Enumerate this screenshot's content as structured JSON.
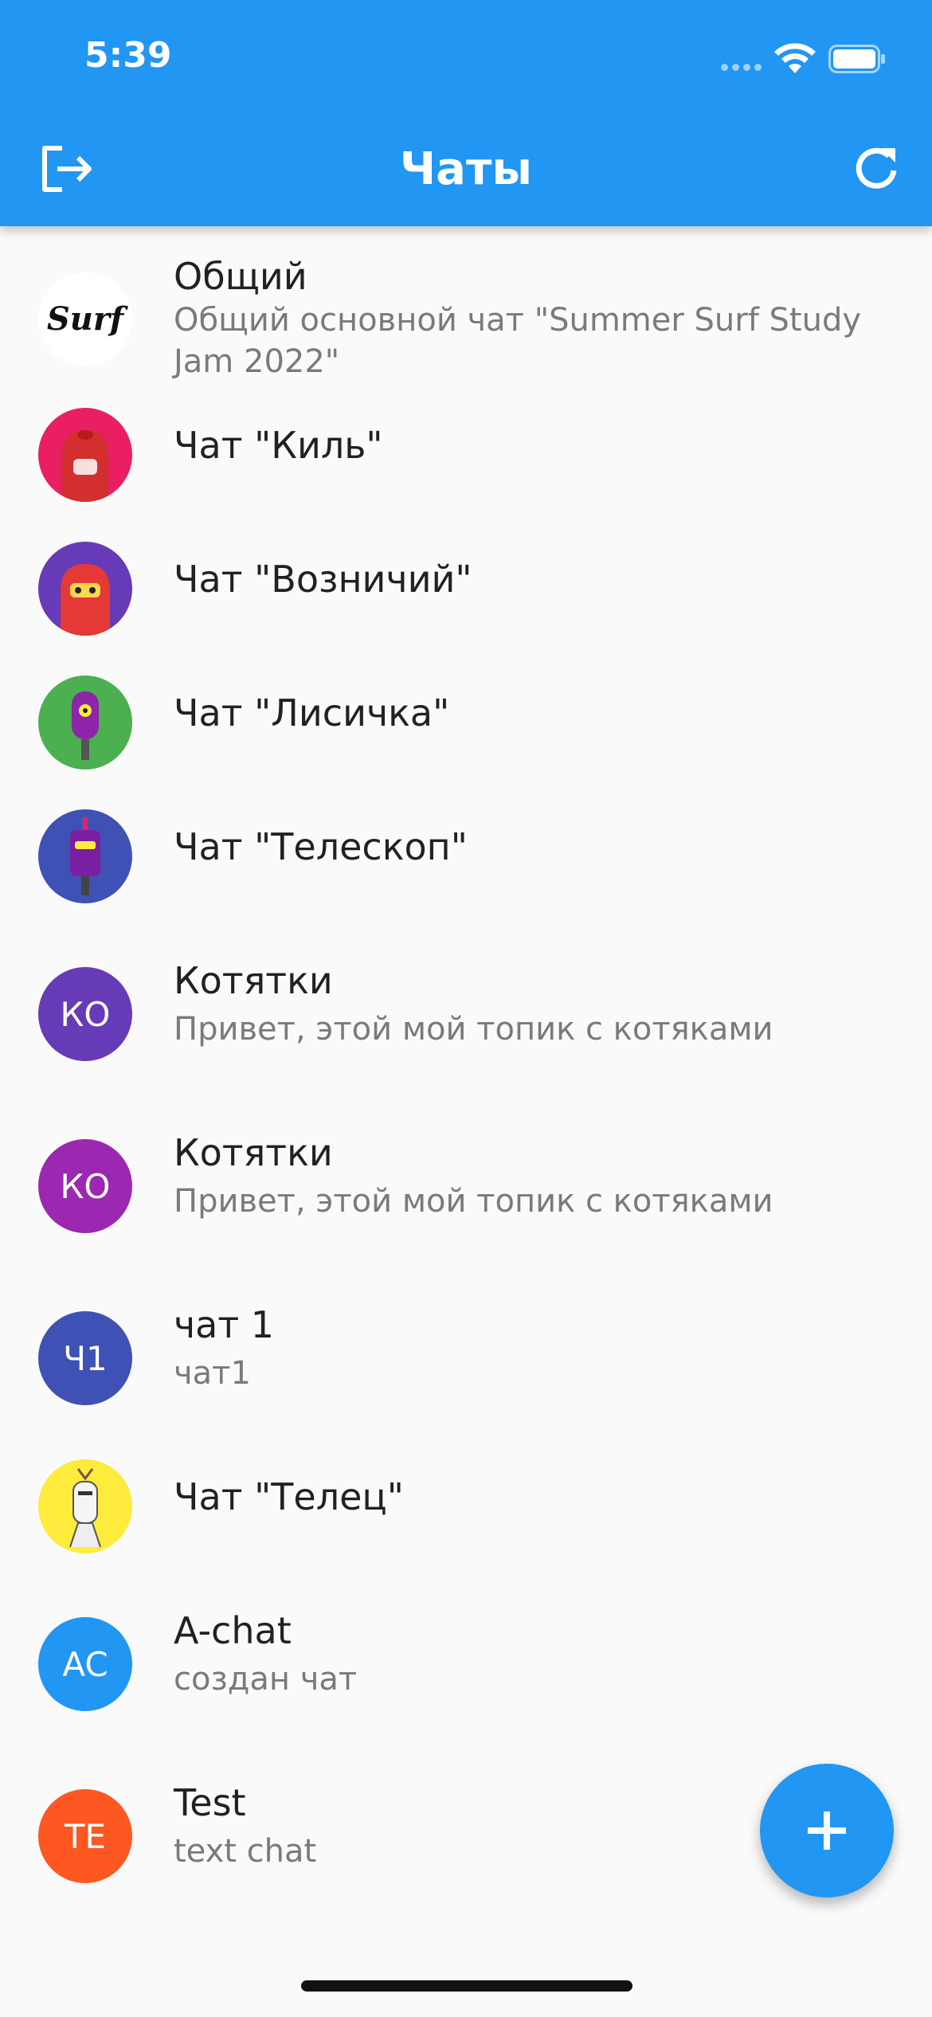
{
  "status_bar": {
    "time": "5:39"
  },
  "app_bar": {
    "title": "Чаты",
    "exit_icon": "logout-icon",
    "refresh_icon": "refresh-icon"
  },
  "chats": [
    {
      "title": "Общий",
      "subtitle": "Общий основной чат \"Summer Surf Study Jam 2022\"",
      "avatar": "surf-logo-image"
    },
    {
      "title": "Чат \"Киль\"",
      "avatar": "robot-image-red",
      "bg": "#e91e63"
    },
    {
      "title": "Чат \"Возничий\"",
      "avatar": "robot-image-purple",
      "bg": "#673ab7"
    },
    {
      "title": "Чат \"Лисичка\"",
      "avatar": "robot-image-green",
      "bg": "#4caf50"
    },
    {
      "title": "Чат \"Телескоп\"",
      "avatar": "robot-image-indigo",
      "bg": "#3f51b5"
    },
    {
      "title": "Котятки",
      "subtitle": "Привет, этой мой топик с котяками",
      "initials": "КО",
      "bg": "#673ab7"
    },
    {
      "title": "Котятки",
      "subtitle": "Привет, этой мой топик с котяками",
      "initials": "КО",
      "bg": "#9c27b0"
    },
    {
      "title": "чат 1",
      "subtitle": "чат1",
      "initials": "Ч1",
      "bg": "#3f51b5"
    },
    {
      "title": "Чат \"Телец\"",
      "avatar": "robot-image-yellow",
      "bg": "#ffeb3b"
    },
    {
      "title": "A-chat",
      "subtitle": "создан чат",
      "initials": "AC",
      "bg": "#2196f3"
    },
    {
      "title": "Test",
      "subtitle": "text chat",
      "initials": "TE",
      "bg": "#ff5722"
    }
  ],
  "fab": {
    "icon": "plus-icon"
  },
  "colors": {
    "primary": "#2196f3",
    "background": "#fafafa"
  }
}
